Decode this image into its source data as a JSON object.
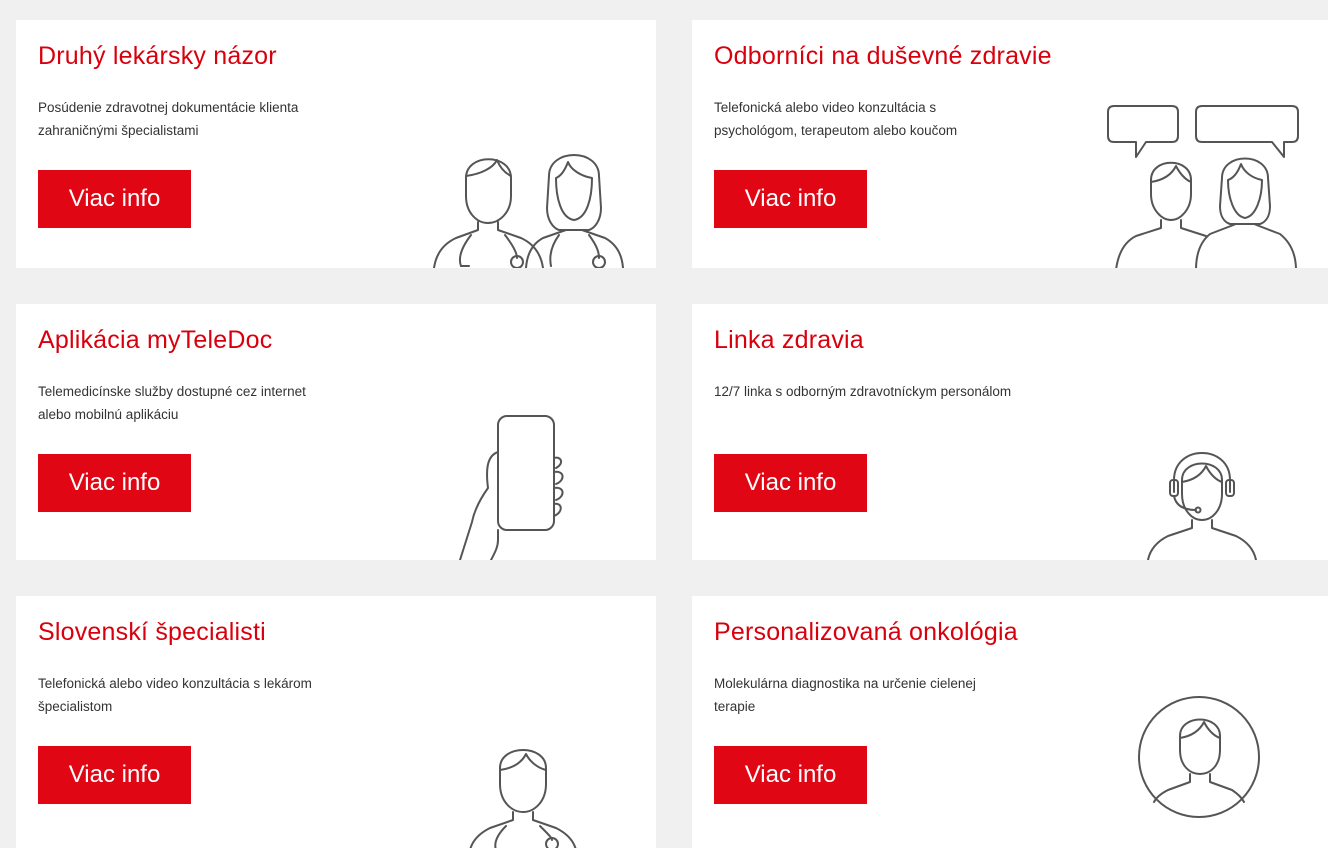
{
  "accent_color": "#e10613",
  "cards": [
    {
      "title": "Druhý lekársky názor",
      "description": "Posúdenie zdravotnej dokumentácie klienta zahraničnými špecialistami",
      "button": "Viac info",
      "icon": "two-doctors-icon"
    },
    {
      "title": "Odborníci na duševné zdravie",
      "description": "Telefonická alebo video konzultácia s psychológom, terapeutom alebo koučom",
      "button": "Viac info",
      "icon": "two-people-speech-bubbles-icon"
    },
    {
      "title": "Aplikácia myTeleDoc",
      "description": "Telemedicínske služby dostupné cez internet alebo mobilnú aplikáciu",
      "button": "Viac info",
      "icon": "hand-holding-phone-icon"
    },
    {
      "title": "Linka zdravia",
      "description": "12/7 linka s odborným zdravotníckym personálom",
      "button": "Viac info",
      "icon": "headset-operator-icon"
    },
    {
      "title": "Slovenskí špecialisti",
      "description": "Telefonická alebo video konzultácia s lekárom špecialistom",
      "button": "Viac info",
      "icon": "doctor-icon"
    },
    {
      "title": "Personalizovaná onkológia",
      "description": "Molekulárna diagnostika na určenie cielenej terapie",
      "button": "Viac info",
      "icon": "person-in-circle-icon"
    }
  ]
}
